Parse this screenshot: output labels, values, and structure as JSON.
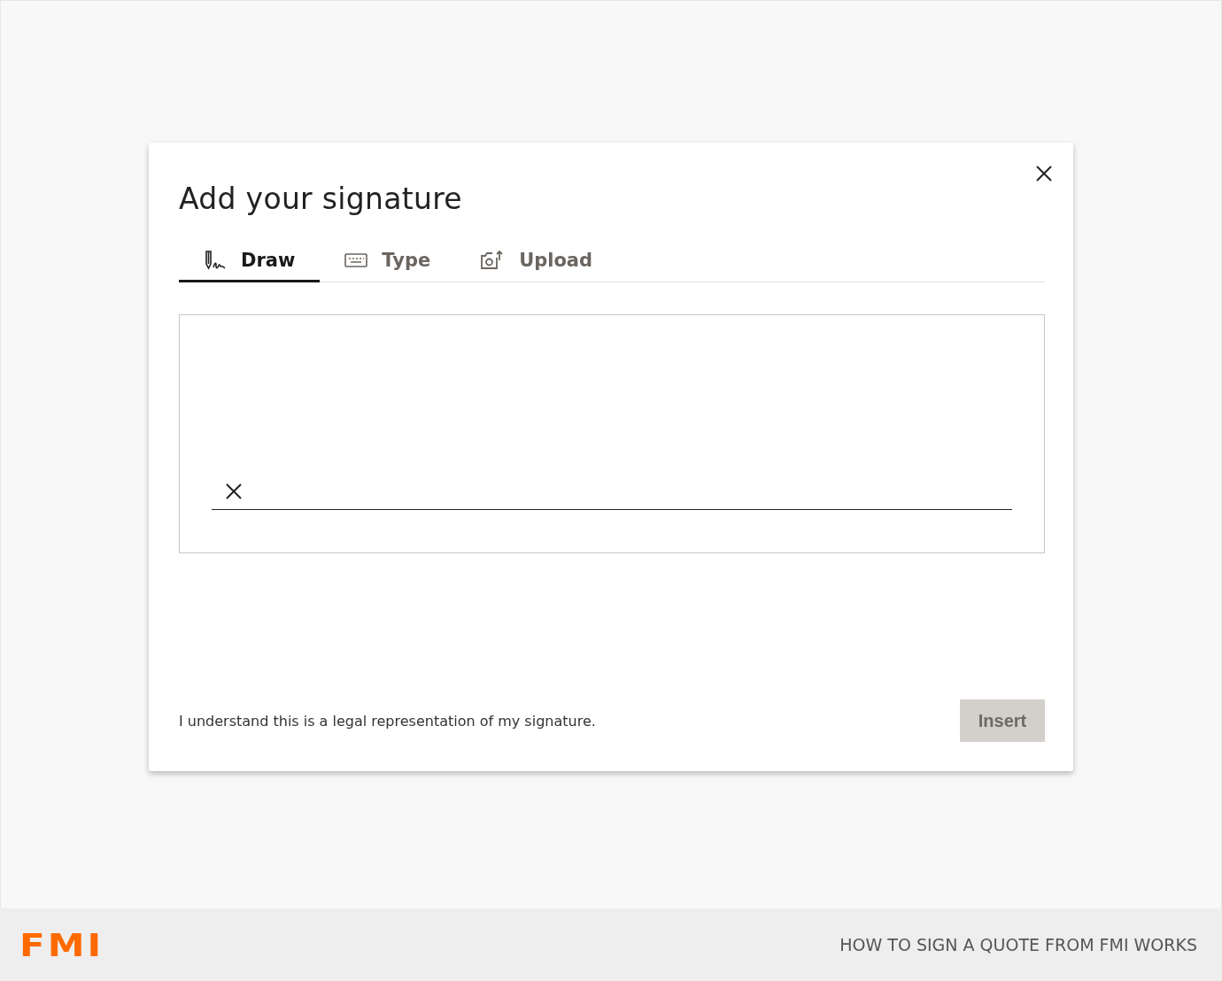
{
  "dialog": {
    "title": "Add your signature",
    "tabs": [
      {
        "label": "Draw",
        "kind": "draw",
        "selected": true
      },
      {
        "label": "Type",
        "kind": "type",
        "selected": false
      },
      {
        "label": "Upload",
        "kind": "upload",
        "selected": false
      }
    ],
    "consent": "I understand this is a legal representation of my signature.",
    "insert_button": {
      "label": "Insert",
      "disabled": true
    }
  },
  "footer": {
    "logo": "FMI",
    "caption": "HOW TO SIGN A QUOTE FROM FMI WORKS"
  }
}
